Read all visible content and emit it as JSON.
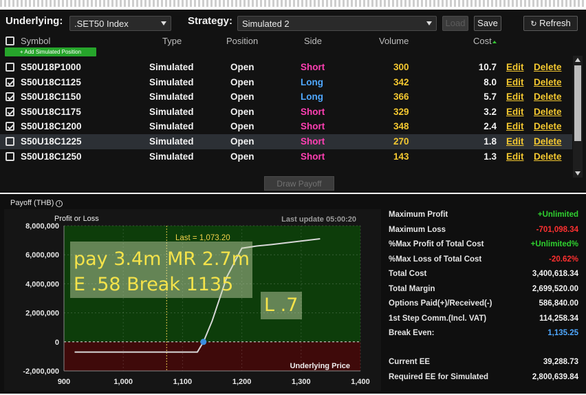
{
  "toolbar": {
    "underlying_label": "Underlying:",
    "underlying_value": ".SET50 Index",
    "strategy_label": "Strategy:",
    "strategy_value": "Simulated 2",
    "load_label": "Load",
    "save_label": "Save",
    "refresh_label": "Refresh"
  },
  "table": {
    "headers": {
      "symbol": "Symbol",
      "type": "Type",
      "position": "Position",
      "side": "Side",
      "volume": "Volume",
      "cost": "Cost"
    },
    "add_label": "+ Add Simulated Position",
    "rows": [
      {
        "checked": false,
        "symbol": "S50U18P1000",
        "type": "Simulated",
        "position": "Open",
        "side": "Short",
        "volume": "300",
        "cost": "10.7",
        "edit": "Edit",
        "delete": "Delete"
      },
      {
        "checked": true,
        "symbol": "S50U18C1125",
        "type": "Simulated",
        "position": "Open",
        "side": "Long",
        "volume": "342",
        "cost": "8.0",
        "edit": "Edit",
        "delete": "Delete"
      },
      {
        "checked": true,
        "symbol": "S50U18C1150",
        "type": "Simulated",
        "position": "Open",
        "side": "Long",
        "volume": "366",
        "cost": "5.7",
        "edit": "Edit",
        "delete": "Delete"
      },
      {
        "checked": true,
        "symbol": "S50U18C1175",
        "type": "Simulated",
        "position": "Open",
        "side": "Short",
        "volume": "329",
        "cost": "3.2",
        "edit": "Edit",
        "delete": "Delete"
      },
      {
        "checked": true,
        "symbol": "S50U18C1200",
        "type": "Simulated",
        "position": "Open",
        "side": "Short",
        "volume": "348",
        "cost": "2.4",
        "edit": "Edit",
        "delete": "Delete"
      },
      {
        "checked": false,
        "symbol": "S50U18C1225",
        "type": "Simulated",
        "position": "Open",
        "side": "Short",
        "volume": "270",
        "cost": "1.8",
        "edit": "Edit",
        "delete": "Delete"
      },
      {
        "checked": false,
        "symbol": "S50U18C1250",
        "type": "Simulated",
        "position": "Open",
        "side": "Short",
        "volume": "143",
        "cost": "1.3",
        "edit": "Edit",
        "delete": "Delete"
      }
    ],
    "draw_payoff_label": "Draw Payoff"
  },
  "payoff": {
    "title": "Payoff (THB)",
    "info_glyph": "i",
    "overlay_line1": "pay 3.4m MR 2.7m",
    "overlay_line2": "E .58 Break 1135",
    "overlay_small": "L .7"
  },
  "chart_data": {
    "type": "line",
    "ylabel": "Profit or Loss",
    "xlabel": "Underlying Price",
    "last_update": "Last update 05:00:20",
    "last_label": "Last = 1,073.20",
    "last_value": 1073.2,
    "breakeven": 1135.25,
    "xlim": [
      900,
      1400
    ],
    "ylim": [
      -2000000,
      8000000
    ],
    "xticks": [
      "900",
      "1,000",
      "1,100",
      "1,200",
      "1,300",
      "1,400"
    ],
    "xtick_values": [
      900,
      1000,
      1100,
      1200,
      1300,
      1400
    ],
    "yticks": [
      "8,000,000",
      "6,000,000",
      "4,000,000",
      "2,000,000",
      "0",
      "-2,000,000"
    ],
    "ytick_values": [
      8000000,
      6000000,
      4000000,
      2000000,
      0,
      -2000000
    ],
    "series": [
      {
        "x": [
          918,
          1125,
          1135.25,
          1150,
          1175,
          1200,
          1225,
          1250,
          1332
        ],
        "y": [
          -701098,
          -701098,
          0,
          1450000,
          4500000,
          6450000,
          6600000,
          6700000,
          7100000
        ]
      }
    ],
    "colors": {
      "profit_bg": "#0d3d0a",
      "loss_bg": "#3f0a0a",
      "line": "#d8d8d8",
      "marker": "#3b8fe0"
    }
  },
  "stats": [
    {
      "label": "Maximum Profit",
      "value": "+Unlimited",
      "color": "#2fd12f"
    },
    {
      "label": "Maximum Loss",
      "value": "-701,098.34",
      "color": "#ff3030"
    },
    {
      "label": "%Max Profit of Total Cost",
      "value": "+Unlimited%",
      "color": "#2fd12f"
    },
    {
      "label": "%Max Loss of Total Cost",
      "value": "-20.62%",
      "color": "#ff3030"
    },
    {
      "label": "Total Cost",
      "value": "3,400,618.34",
      "color": "#f2f2f2"
    },
    {
      "label": "Total Margin",
      "value": "2,699,520.00",
      "color": "#f2f2f2"
    },
    {
      "label": "Options Paid(+)/Received(-)",
      "value": "586,840.00",
      "color": "#f2f2f2"
    },
    {
      "label": "1st Step Comm.(Incl. VAT)",
      "value": "114,258.34",
      "color": "#f2f2f2"
    },
    {
      "label": "Break Even:",
      "value": "1,135.25",
      "color": "#4fa8ff"
    },
    {
      "label": "Current EE",
      "value": "39,288.73",
      "color": "#f2f2f2"
    },
    {
      "label": "Required EE for Simulated",
      "value": "2,800,639.84",
      "color": "#f2f2f2"
    }
  ]
}
